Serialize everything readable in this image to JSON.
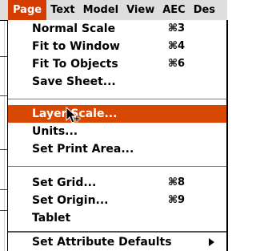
{
  "menubar": {
    "items": [
      "Page",
      "Text",
      "Model",
      "View",
      "AEC",
      "Des"
    ],
    "active": "Page"
  },
  "menu": {
    "items": [
      {
        "label": "Normal Scale",
        "shortcut": "⌘3"
      },
      {
        "label": "Fit to Window",
        "shortcut": "⌘4"
      },
      {
        "label": "Fit To Objects",
        "shortcut": "⌘6"
      },
      {
        "label": "Save Sheet...",
        "shortcut": ""
      },
      {
        "label": "Layer Scale...",
        "shortcut": ""
      },
      {
        "label": "Units...",
        "shortcut": ""
      },
      {
        "label": "Set Print Area...",
        "shortcut": ""
      },
      {
        "label": "Set Grid...",
        "shortcut": "⌘8"
      },
      {
        "label": "Set Origin...",
        "shortcut": "⌘9"
      },
      {
        "label": "Tablet",
        "shortcut": ""
      },
      {
        "label": "Set Attribute Defaults",
        "shortcut": ""
      }
    ],
    "highlighted": "Layer Scale...",
    "submenu_icon": "triangle-right-icon"
  },
  "colors": {
    "highlight": "#d94800",
    "menubar_bg": "#dedede"
  }
}
